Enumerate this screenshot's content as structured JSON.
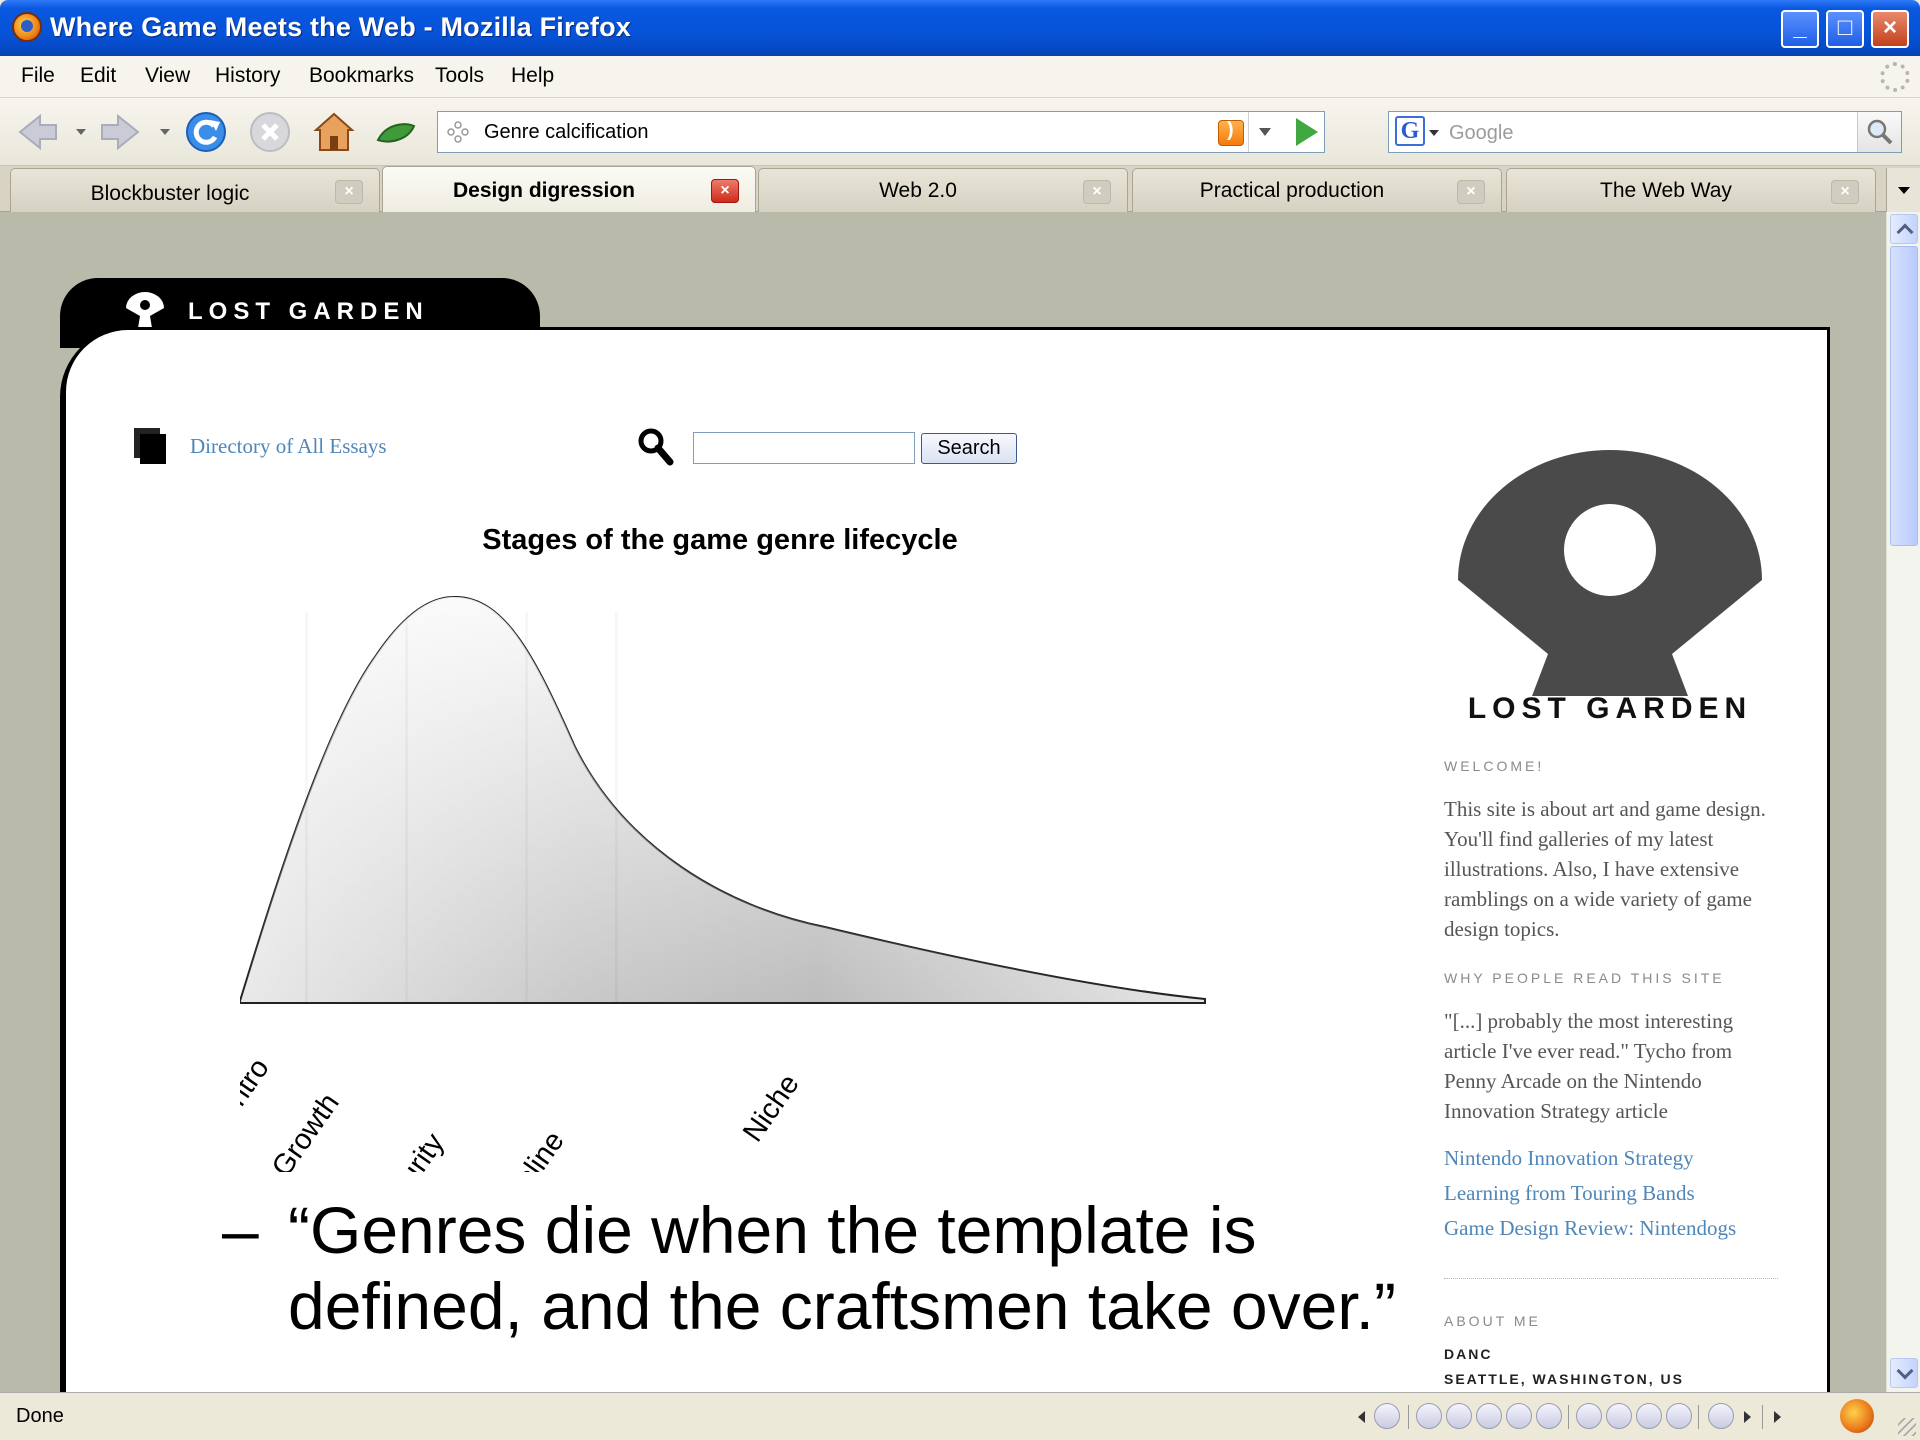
{
  "window": {
    "title": "Where Game Meets the Web - Mozilla Firefox",
    "minimize_icon": "minimize-icon",
    "maximize_icon": "maximize-icon",
    "close_icon": "close-icon"
  },
  "menu": {
    "items": [
      {
        "label": "File"
      },
      {
        "label": "Edit"
      },
      {
        "label": "View"
      },
      {
        "label": "History"
      },
      {
        "label": "Bookmarks"
      },
      {
        "label": "Tools"
      },
      {
        "label": "Help"
      }
    ]
  },
  "toolbar": {
    "url": "Genre calcification",
    "search_placeholder": "Google",
    "search_engine_letter": "G"
  },
  "tabs": [
    {
      "label": "Blockbuster logic",
      "active": false
    },
    {
      "label": "Design digression",
      "active": true
    },
    {
      "label": "Web 2.0",
      "active": false
    },
    {
      "label": "Practical production",
      "active": false
    },
    {
      "label": "The Web Way",
      "active": false
    }
  ],
  "site": {
    "name": "LOST GARDEN",
    "directory_link": "Directory of All Essays",
    "search_button": "Search",
    "quote_dash": "–",
    "quote_line1": "“Genres die when the template is",
    "quote_line2": "defined, and the craftsmen take over.”"
  },
  "chart_data": {
    "type": "area",
    "title": "Stages of the game genre lifecycle",
    "categories": [
      "Intro",
      "Growth",
      "Maturity",
      "Decline",
      "Niche"
    ],
    "xlabel": "",
    "ylabel": "",
    "grid": false,
    "legend": "none"
  },
  "sidebar": {
    "logo_name": "LOST GARDEN",
    "welcome_heading": "WELCOME!",
    "welcome_text": "This site is about art and game design. You'll find galleries of my latest illustrations. Also, I have extensive ramblings on a wide variety of game design topics.",
    "why_heading": "WHY PEOPLE READ THIS SITE",
    "why_text": "\"[...] probably the most interesting article I've ever read.\" Tycho from Penny Arcade on the Nintendo Innovation Strategy article",
    "links": [
      "Nintendo Innovation Strategy",
      "Learning from Touring Bands",
      "Game Design Review: Nintendogs"
    ],
    "about_heading": "ABOUT ME",
    "about_name": "DANC",
    "about_location": "SEATTLE, WASHINGTON, US"
  },
  "status": {
    "text": "Done"
  },
  "colors": {
    "titlebar": "#0653d8",
    "content_bg": "#babaaa",
    "link": "#4f86b8"
  }
}
